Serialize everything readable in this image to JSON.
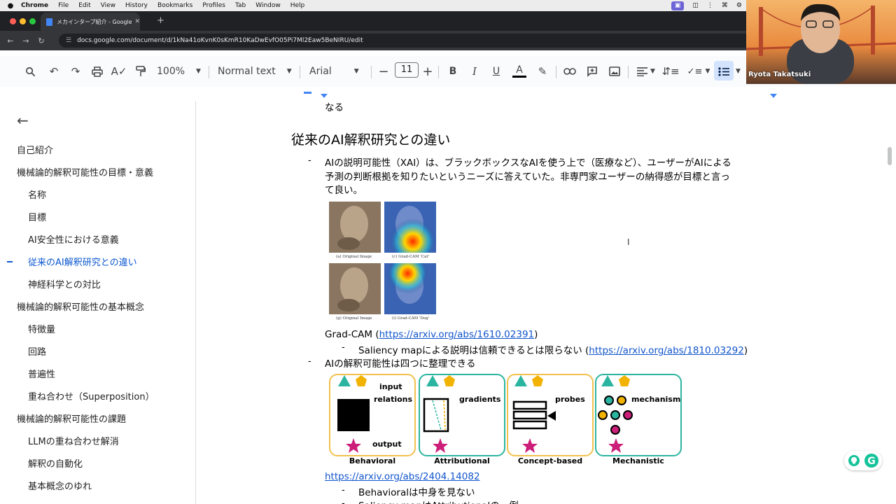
{
  "menubar": {
    "app": "Chrome",
    "items": [
      "File",
      "Edit",
      "View",
      "History",
      "Bookmarks",
      "Profiles",
      "Tab",
      "Window",
      "Help"
    ]
  },
  "browser": {
    "tab_title": "メカインタープ紹介 - Google D",
    "url": "docs.google.com/document/d/1kNa41oKvnK0sKmR10KaDwEvfO05Pi7Ml2Eaw5BeNIRU/edit"
  },
  "docs_toolbar": {
    "zoom": "100%",
    "style": "Normal text",
    "font": "Arial",
    "font_size": "11"
  },
  "outline": {
    "items": [
      {
        "label": "自己紹介",
        "level": 1
      },
      {
        "label": "機械論的解釈可能性の目標・意義",
        "level": 1
      },
      {
        "label": "名称",
        "level": 2
      },
      {
        "label": "目標",
        "level": 2
      },
      {
        "label": "AI安全性における意義",
        "level": 2
      },
      {
        "label": "従来のAI解釈研究との違い",
        "level": 2,
        "active": true
      },
      {
        "label": "神経科学との対比",
        "level": 2
      },
      {
        "label": "機械論的解釈可能性の基本概念",
        "level": 1
      },
      {
        "label": "特徴量",
        "level": 2
      },
      {
        "label": "回路",
        "level": 2
      },
      {
        "label": "普遍性",
        "level": 2
      },
      {
        "label": "重ね合わせ（Superposition）",
        "level": 2
      },
      {
        "label": "機械論的解釈可能性の課題",
        "level": 1
      },
      {
        "label": "LLMの重ね合わせ解消",
        "level": 2
      },
      {
        "label": "解釈の自動化",
        "level": 2
      },
      {
        "label": "基本概念のゆれ",
        "level": 2
      }
    ]
  },
  "doc": {
    "prev_tail": "なる",
    "heading": "従来のAI解釈研究との違い",
    "bullet1_line1": "AIの説明可能性（XAI）は、ブラックボックスなAIを使う上で（医療など）、ユーザーがAIによる",
    "bullet1_line2": "予測の判断根拠を知りたいというニーズに答えていた。非専門家ユーザーの納得感が目標と言っ",
    "bullet1_line3": "て良い。",
    "gradcam_prefix": "Grad-CAM (",
    "gradcam_link": "https://arxiv.org/abs/1610.02391",
    "gradcam_suffix": ")",
    "sub1_prefix": "Saliency mapによる説明は信頼できるとは限らない (",
    "sub1_link": "https://arxiv.org/abs/1810.03292",
    "sub1_suffix": ")",
    "bullet2": "AIの解釈可能性は四つに整理できる",
    "link2": "https://arxiv.org/abs/2404.14082",
    "sub2": "Behavioralは中身を見ない",
    "sub3": "Saliency mapはAttributionalの一例",
    "dash": "-"
  },
  "gradcam_figure": {
    "captions": [
      "(a) Original Image",
      "(c) Grad-CAM 'Cat'",
      "(g) Original Image",
      "(i) Grad-CAM 'Dog'"
    ]
  },
  "interp_figure": {
    "cards": [
      {
        "label": "Behavioral",
        "color": "#f2c14e"
      },
      {
        "label": "Attributional",
        "color": "#2bb5a0"
      },
      {
        "label": "Concept-based",
        "color": "#f2c14e"
      },
      {
        "label": "Mechanistic",
        "color": "#2bb5a0"
      }
    ],
    "texts": {
      "input": "input",
      "relations": "relations",
      "output": "output",
      "gradients": "gradients",
      "probes": "probes",
      "mechanism": "mechanism"
    }
  },
  "webcam": {
    "name": "Ryota Takatsuki"
  }
}
